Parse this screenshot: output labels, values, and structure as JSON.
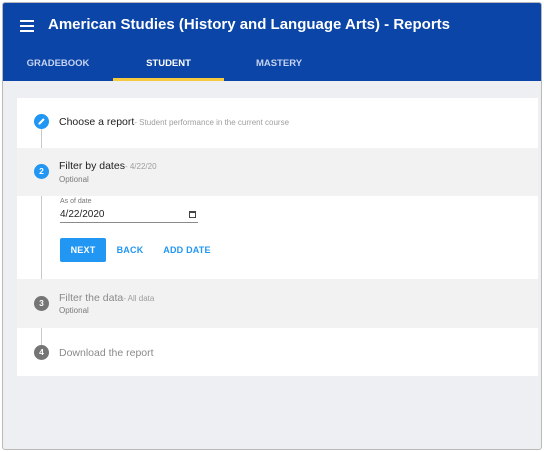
{
  "app": {
    "title": "American Studies (History and Language Arts) - Reports"
  },
  "tabs": [
    {
      "label": "GRADEBOOK"
    },
    {
      "label": "STUDENT"
    },
    {
      "label": "MASTERY"
    }
  ],
  "steps": [
    {
      "number": "",
      "icon": "pencil-icon",
      "title": "Choose a report",
      "summary": "- Student performance in the current course",
      "optional": ""
    },
    {
      "number": "2",
      "title": "Filter by dates",
      "summary": "- 4/22/20",
      "optional": "Optional"
    },
    {
      "number": "3",
      "title": "Filter the data",
      "summary": "- All data",
      "optional": "Optional"
    },
    {
      "number": "4",
      "title": "Download the report",
      "summary": "",
      "optional": ""
    }
  ],
  "date_filter": {
    "label": "As of date",
    "value": "4/22/2020",
    "icon": "calendar-icon"
  },
  "actions": {
    "next": "NEXT",
    "back": "BACK",
    "add_date": "ADD DATE"
  },
  "colors": {
    "appbar": "#0b45a8",
    "accent": "#2196f3",
    "tab_indicator": "#f7c93e"
  }
}
